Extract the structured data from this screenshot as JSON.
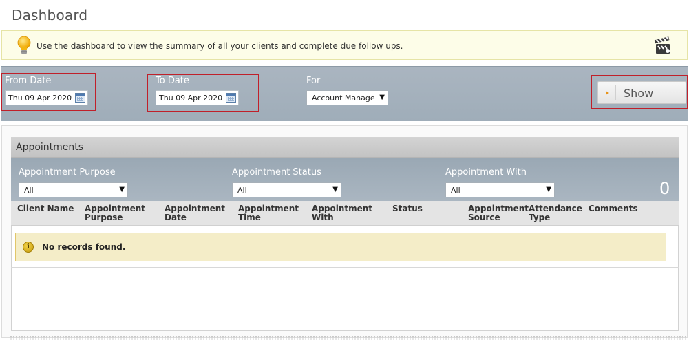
{
  "page": {
    "title": "Dashboard"
  },
  "info": {
    "text": "Use the dashboard to view the summary of all your clients and complete due follow ups."
  },
  "filters": {
    "from_label": "From Date",
    "from_value": "Thu 09 Apr 2020",
    "to_label": "To Date",
    "to_value": "Thu 09 Apr 2020",
    "for_label": "For",
    "for_value": "Account Manage",
    "show_label": "Show"
  },
  "appointments": {
    "title": "Appointments",
    "purpose_label": "Appointment Purpose",
    "purpose_value": "All",
    "status_label": "Appointment Status",
    "status_value": "All",
    "with_label": "Appointment With",
    "with_value": "All",
    "count": "0",
    "columns": [
      "Client Name",
      "Appointment Purpose",
      "Appointment Date",
      "Appointment Time",
      "Appointment With",
      "Status",
      "Appointment Source",
      "Attendance Type",
      "Comments"
    ],
    "empty_message": "No records found."
  },
  "colors": {
    "highlight_border": "#c0202a",
    "filter_bar": "#a5b2bd",
    "notice_bg": "#f4edc8"
  },
  "icons": [
    "lightbulb-icon",
    "video-clapper-icon",
    "calendar-icon",
    "info-icon",
    "dropdown-arrow-icon",
    "play-arrow-icon"
  ]
}
